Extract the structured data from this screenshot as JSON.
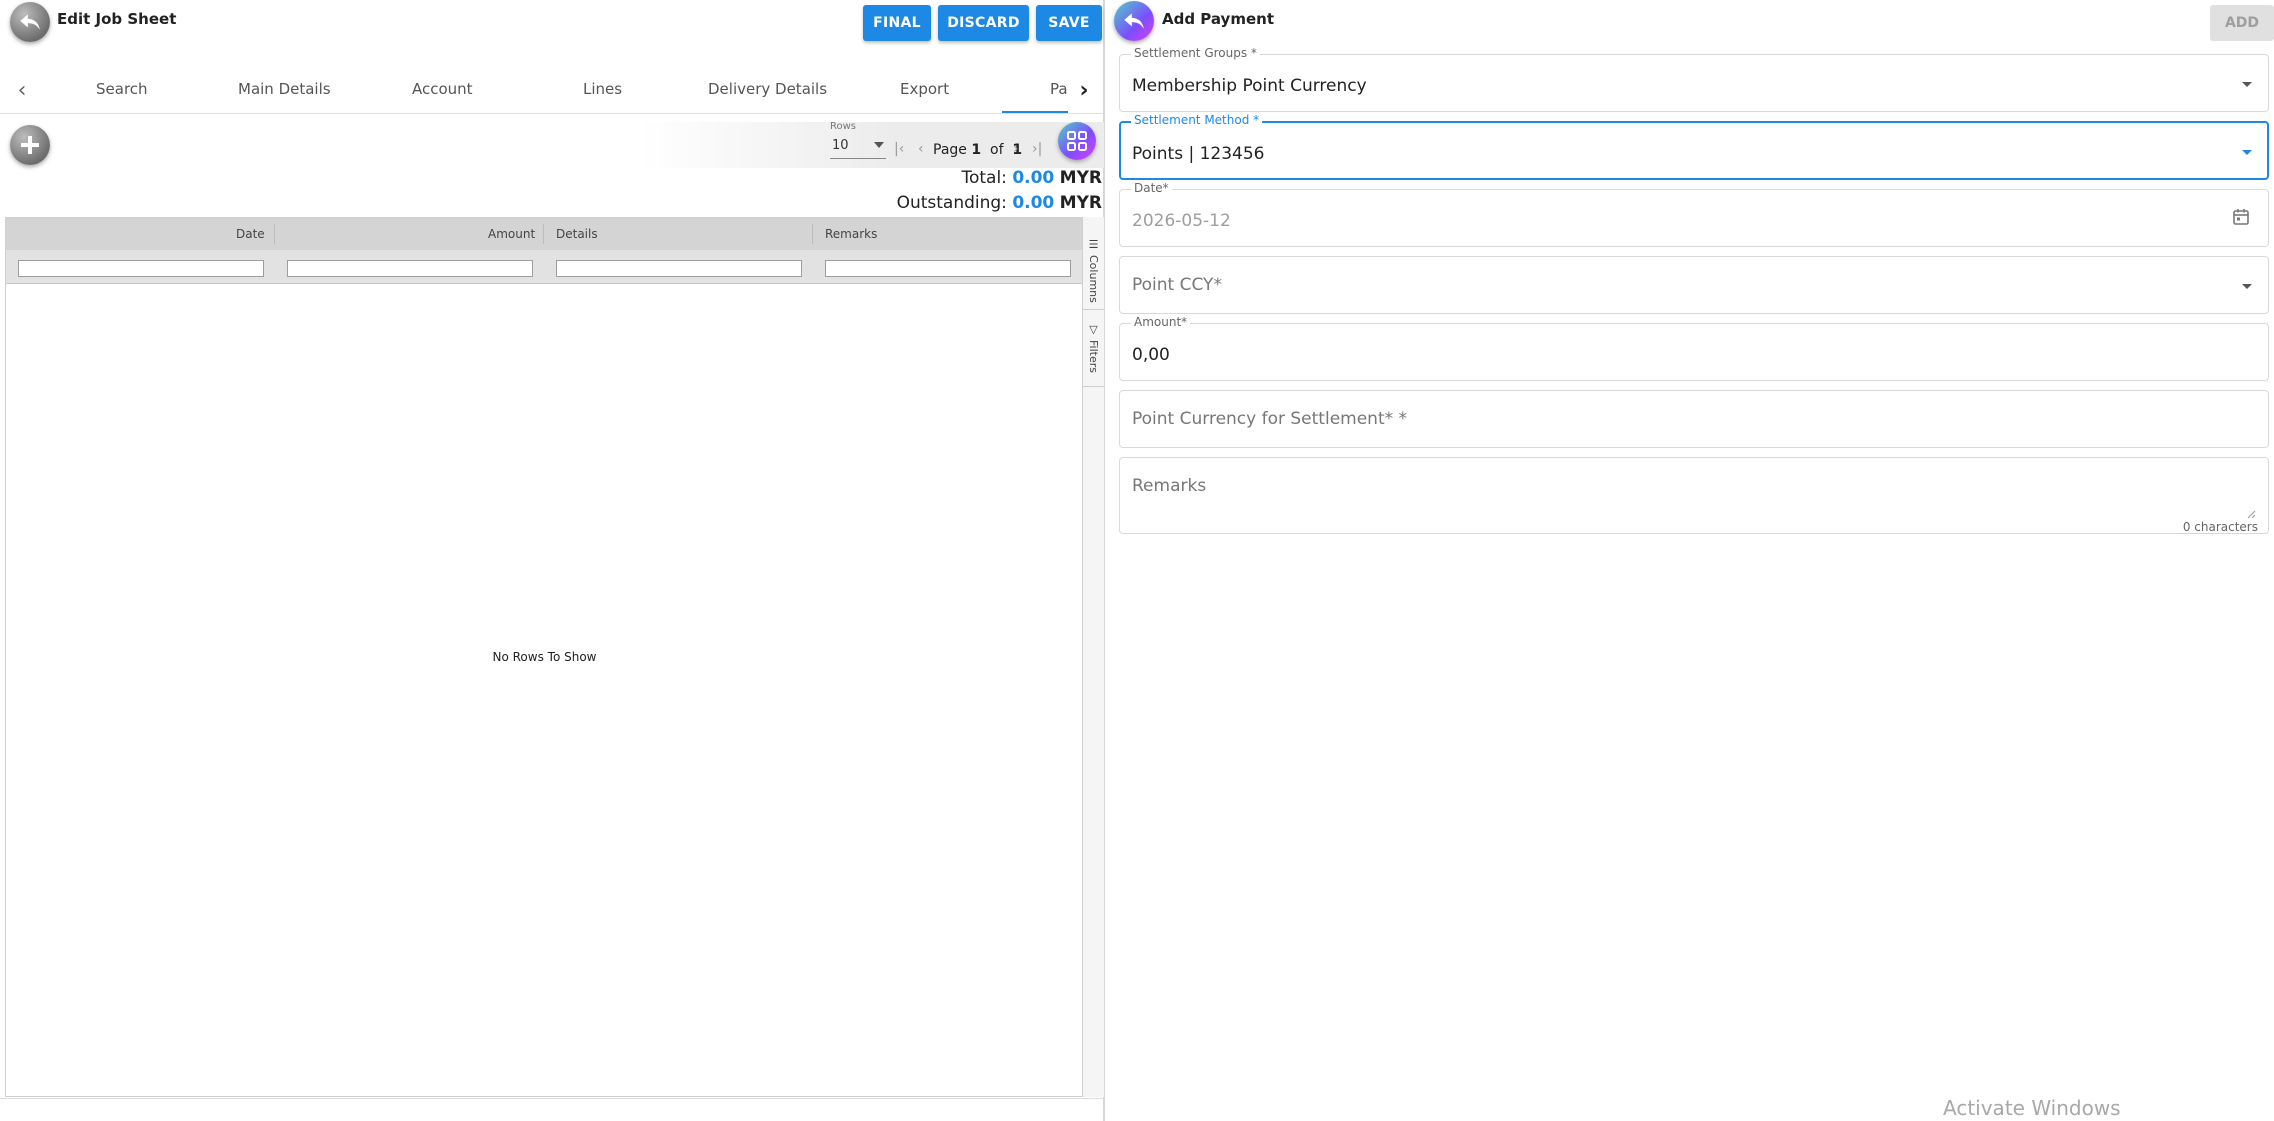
{
  "left": {
    "title": "Edit Job Sheet",
    "buttons": {
      "final": "FINAL",
      "discard": "DISCARD",
      "save": "SAVE"
    },
    "tabs": [
      {
        "label": "Search"
      },
      {
        "label": "Main Details"
      },
      {
        "label": "Account"
      },
      {
        "label": "Lines"
      },
      {
        "label": "Delivery Details"
      },
      {
        "label": "Export"
      },
      {
        "label": "Pa",
        "active": true
      }
    ],
    "pager": {
      "rows_label": "Rows",
      "rows_value": "10",
      "page_word": "Page",
      "current_page": "1",
      "of_word": "of",
      "total_pages": "1"
    },
    "totals": {
      "total_label": "Total:",
      "total_value": "0.00",
      "outstanding_label": "Outstanding:",
      "outstanding_value": "0.00",
      "currency": "MYR"
    },
    "grid": {
      "columns": [
        "Date",
        "Amount",
        "Details",
        "Remarks"
      ],
      "empty_message": "No Rows To Show",
      "side_tabs": {
        "columns": "Columns",
        "filters": "Filters"
      }
    }
  },
  "right": {
    "title": "Add Payment",
    "add_button": "ADD",
    "fields": {
      "settlement_groups": {
        "label": "Settlement Groups *",
        "value": "Membership Point Currency"
      },
      "settlement_method": {
        "label": "Settlement Method *",
        "value": "Points | 123456"
      },
      "date": {
        "label": "Date*",
        "value": "2026-05-12"
      },
      "point_ccy": {
        "placeholder": "Point CCY*"
      },
      "amount": {
        "label": "Amount*",
        "value": "0,00"
      },
      "point_currency_settlement": {
        "placeholder": "Point Currency for Settlement* *"
      },
      "remarks": {
        "placeholder": "Remarks",
        "char_count": "0 characters"
      }
    }
  },
  "os": {
    "watermark": "Activate Windows"
  },
  "colors": {
    "primary": "#1e88e5",
    "disabled_bg": "#e0e0e0",
    "grid_header": "#d4d4d4"
  },
  "icons": [
    "back-arrow-icon",
    "plus-icon",
    "grid-view-icon",
    "chevron-left-icon",
    "chevron-right-icon",
    "calendar-icon",
    "dropdown-caret-icon"
  ]
}
